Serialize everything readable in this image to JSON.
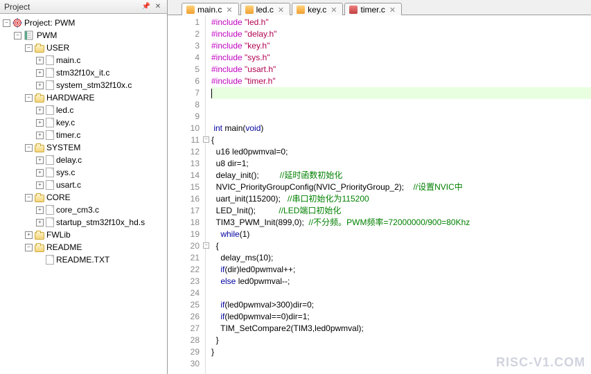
{
  "panel": {
    "title": "Project"
  },
  "tree": {
    "root": "Project: PWM",
    "target": "PWM",
    "groups": [
      {
        "name": "USER",
        "files": [
          "main.c",
          "stm32f10x_it.c",
          "system_stm32f10x.c"
        ]
      },
      {
        "name": "HARDWARE",
        "files": [
          "led.c",
          "key.c",
          "timer.c"
        ]
      },
      {
        "name": "SYSTEM",
        "files": [
          "delay.c",
          "sys.c",
          "usart.c"
        ]
      },
      {
        "name": "CORE",
        "files": [
          "core_cm3.c",
          "startup_stm32f10x_hd.s"
        ]
      },
      {
        "name": "FWLib",
        "files": []
      },
      {
        "name": "README",
        "files": [
          "README.TXT"
        ]
      }
    ]
  },
  "tabs": [
    {
      "label": "main.c",
      "color": "orange",
      "active": true
    },
    {
      "label": "led.c",
      "color": "orange",
      "active": false
    },
    {
      "label": "key.c",
      "color": "orange",
      "active": false
    },
    {
      "label": "timer.c",
      "color": "red",
      "active": false
    }
  ],
  "code": {
    "lines": [
      {
        "n": 1,
        "pp": "#include ",
        "str": "\"led.h\""
      },
      {
        "n": 2,
        "pp": "#include ",
        "str": "\"delay.h\""
      },
      {
        "n": 3,
        "pp": "#include ",
        "str": "\"key.h\""
      },
      {
        "n": 4,
        "pp": "#include ",
        "str": "\"sys.h\""
      },
      {
        "n": 5,
        "pp": "#include ",
        "str": "\"usart.h\""
      },
      {
        "n": 6,
        "pp": "#include ",
        "str": "\"timer.h\""
      },
      {
        "n": 7,
        "hl": true,
        "cursor": true
      },
      {
        "n": 8
      },
      {
        "n": 9
      },
      {
        "n": 10,
        "text_plain": " ",
        "kw": "int",
        "text2": " main(",
        "kw2": "void",
        "text3": ")"
      },
      {
        "n": 11,
        "fold": true,
        "text_plain": "{"
      },
      {
        "n": 12,
        "text_plain": "  u16 led0pwmval=0;"
      },
      {
        "n": 13,
        "text_plain": "  u8 dir=1;"
      },
      {
        "n": 14,
        "text_plain": "  delay_init();         ",
        "cmt": "//延时函数初始化"
      },
      {
        "n": 15,
        "text_plain": "  NVIC_PriorityGroupConfig(NVIC_PriorityGroup_2);    ",
        "cmt": "//设置NVIC中"
      },
      {
        "n": 16,
        "text_plain": "  uart_init(115200);   ",
        "cmt": "//串口初始化为115200"
      },
      {
        "n": 17,
        "text_plain": "  LED_Init();          ",
        "cmt": "//LED端口初始化"
      },
      {
        "n": 18,
        "text_plain": "  TIM3_PWM_Init(899,0);  ",
        "cmt": "//不分频。PWM频率=72000000/900=80Khz"
      },
      {
        "n": 19,
        "text_plain": "    ",
        "kw": "while",
        "text2": "(1)"
      },
      {
        "n": 20,
        "fold": true,
        "text_plain": "  {"
      },
      {
        "n": 21,
        "text_plain": "    delay_ms(10);"
      },
      {
        "n": 22,
        "text_plain": "    ",
        "kw": "if",
        "text2": "(dir)led0pwmval++;"
      },
      {
        "n": 23,
        "text_plain": "    ",
        "kw": "else",
        "text2": " led0pwmval--;"
      },
      {
        "n": 24
      },
      {
        "n": 25,
        "text_plain": "    ",
        "kw": "if",
        "text2": "(led0pwmval>300)dir=0;"
      },
      {
        "n": 26,
        "text_plain": "    ",
        "kw": "if",
        "text2": "(led0pwmval==0)dir=1;"
      },
      {
        "n": 27,
        "text_plain": "    TIM_SetCompare2(TIM3,led0pwmval);"
      },
      {
        "n": 28,
        "text_plain": "  }"
      },
      {
        "n": 29,
        "text_plain": "}"
      },
      {
        "n": 30
      }
    ]
  },
  "watermark": "RISC-V1.COM"
}
